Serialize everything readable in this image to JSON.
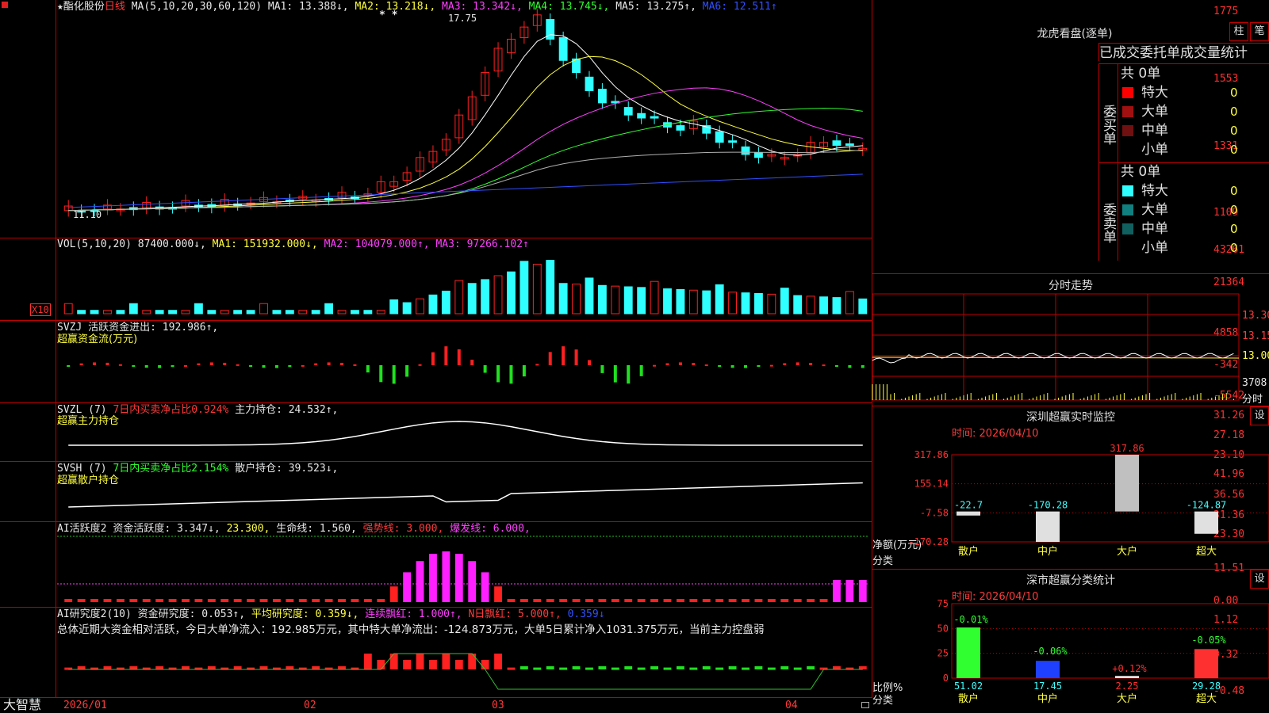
{
  "app": {
    "brand": "大智慧",
    "stock_name": "酯化股份",
    "period": "日线"
  },
  "colors": {
    "up": "#ff2020",
    "down": "#30ffff",
    "ma1": "#ffffff",
    "ma2": "#ffff40",
    "ma3": "#ff40ff",
    "ma4": "#30ff30",
    "ma5": "#b0b0b0",
    "ma6": "#3050ff"
  },
  "kline": {
    "ma_params": "MA(5,10,20,30,60,120)",
    "ma1": "MA1: 13.388↓,",
    "ma2": "MA2: 13.218↓,",
    "ma3": "MA3: 13.342↓,",
    "ma4": "MA4: 13.745↓,",
    "ma5": "MA5: 13.275↑,",
    "ma6": "MA6: 12.511↑",
    "y_ticks": [
      "1775",
      "1553",
      "1331",
      "1109"
    ],
    "high_label": "17.75",
    "low_label": "11.10",
    "stars": "* *"
  },
  "vol": {
    "title": "VOL(5,10,20)",
    "v": "87400.000↓,",
    "ma1": "MA1: 151932.000↓,",
    "ma2": "MA2: 104079.000↑,",
    "ma3": "MA3: 97266.102↑",
    "y_ticks": [
      "43261",
      "21364"
    ],
    "unit": "X10"
  },
  "svzj": {
    "title": "SVZJ",
    "line": "活跃资金进出: 192.986↑,",
    "sub": "超赢资金流(万元)",
    "y_ticks": [
      "4858",
      "-342",
      "-5542"
    ]
  },
  "svzl": {
    "title": "SVZL (7)",
    "ratio": "7日内买卖净占比0.924%",
    "hold": "主力持仓: 24.532↑,",
    "sub": "超赢主力持仓",
    "y_ticks": [
      "31.26",
      "27.18",
      "23.10"
    ]
  },
  "svsh": {
    "title": "SVSH (7)",
    "ratio": "7日内买卖净占比2.154%",
    "hold": "散户持仓: 39.523↓,",
    "sub": "超赢散户持仓",
    "y_ticks": [
      "41.96",
      "36.56",
      "31.36"
    ]
  },
  "ai_active": {
    "title": "AI活跃度2",
    "a": "资金活跃度: 3.347↓,",
    "b": "23.300,",
    "c": "生命线: 1.560,",
    "d": "强势线: 3.000,",
    "e": "爆发线: 6.000,",
    "y_ticks": [
      "23.30",
      "11.51",
      "0.00"
    ]
  },
  "ai_research": {
    "title": "AI研究度2(10)",
    "a": "资金研究度: 0.053↑,",
    "b": "平均研究度: 0.359↓,",
    "c": "连续飘红: 1.000↑,",
    "d": "N日飘红: 5.000↑,",
    "e": "0.359↓",
    "summary": "总体近期大资金相对活跃，今日大单净流入：192.985万元，其中特大单净流出：-124.873万元，大单5日累计净入1031.375万元，当前主力控盘弱",
    "y_ticks": [
      "1.12",
      "0.32",
      "-0.48"
    ]
  },
  "x_axis": [
    "2026/01",
    "02",
    "03",
    "04"
  ],
  "dragon": {
    "title": "龙虎看盘(逐单)",
    "btn1": "柱",
    "btn2": "笔",
    "heading": "已成交委托单成交量统计",
    "buy_label": "委买单",
    "sell_label": "委卖单",
    "buy_total": "共 0单",
    "sell_total": "共 0单",
    "buy_rows": [
      {
        "label": "特大",
        "val": "0",
        "pct": "0%",
        "color": "#ff0000"
      },
      {
        "label": "大单",
        "val": "0",
        "pct": "0%",
        "color": "#a01010"
      },
      {
        "label": "中单",
        "val": "0",
        "pct": "0%",
        "color": "#701010"
      },
      {
        "label": "小单",
        "val": "0",
        "pct": "0%",
        "color": "#000000"
      }
    ],
    "sell_rows": [
      {
        "label": "特大",
        "val": "0",
        "pct": "0%",
        "color": "#30ffff"
      },
      {
        "label": "大单",
        "val": "0",
        "pct": "0%",
        "color": "#108080"
      },
      {
        "label": "中单",
        "val": "0",
        "pct": "0%",
        "color": "#106060"
      },
      {
        "label": "小单",
        "val": "0",
        "pct": "0%",
        "color": "#000000"
      }
    ]
  },
  "intraday": {
    "title": "分时走势",
    "prices": [
      "13.30",
      "13.15",
      "13.00"
    ],
    "vol": "3708",
    "unit": "分时"
  },
  "sz_monitor": {
    "title": "深圳超赢实时监控",
    "settings": "设",
    "time": "时间: 2026/04/10",
    "y_ticks": [
      "317.86",
      "155.14",
      "-7.58",
      "-170.28"
    ],
    "ylabel": "净额(万元)",
    "xlabel": "分类",
    "categories": [
      "散户",
      "中户",
      "大户",
      "超大"
    ],
    "values": [
      -22.7,
      -170.28,
      317.86,
      -124.87
    ],
    "value_labels": [
      "-22.7",
      "-170.28",
      "317.86",
      "-124.87"
    ]
  },
  "sz_class": {
    "title": "深市超赢分类统计",
    "settings": "设",
    "time": "时间: 2026/04/10",
    "y_ticks": [
      "75",
      "50",
      "25",
      "0"
    ],
    "ylabel": "比例%",
    "xlabel": "分类",
    "categories": [
      "散户",
      "中户",
      "大户",
      "超大"
    ],
    "values": [
      51.02,
      17.45,
      2.25,
      29.28
    ],
    "value_labels": [
      "51.02",
      "17.45",
      "2.25",
      "29.28"
    ],
    "changes": [
      "-0.01%",
      "-0.06%",
      "+0.12%",
      "-0.05%"
    ]
  }
}
